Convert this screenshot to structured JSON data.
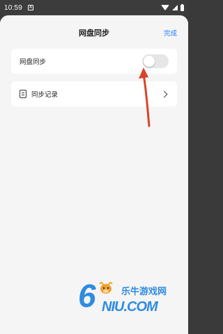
{
  "status_bar": {
    "time": "10:59",
    "app_icon": "A"
  },
  "header": {
    "title": "网盘同步",
    "done_label": "完成"
  },
  "sync_card": {
    "label": "网盘同步",
    "toggle_on": false
  },
  "records_card": {
    "label": "同步记录"
  },
  "watermark": {
    "digit": "6",
    "brand": "乐牛游戏网",
    "domain": "NIU.COM"
  },
  "colors": {
    "accent": "#1e7bff",
    "annotation_arrow": "#d9432b",
    "watermark": "#2f8be0"
  }
}
